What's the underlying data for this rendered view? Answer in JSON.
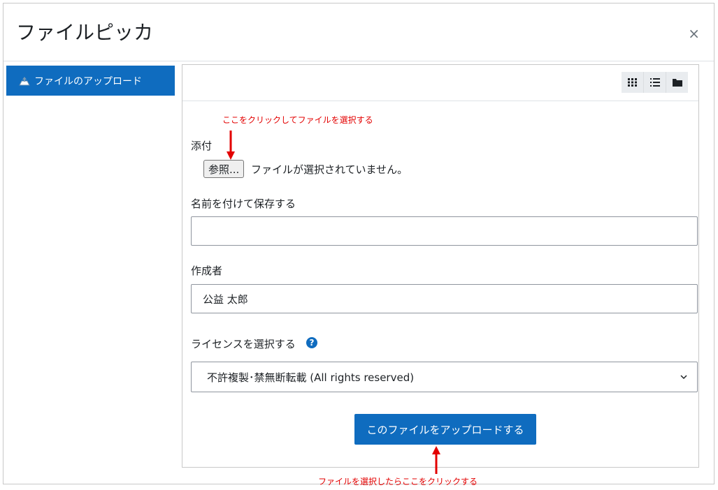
{
  "dialog": {
    "title": "ファイルピッカ",
    "close_label": "×"
  },
  "sidebar": {
    "items": [
      {
        "label": "ファイルのアップロード",
        "icon": "upload-icon",
        "active": true
      }
    ]
  },
  "toolbar": {
    "view_buttons": [
      {
        "icon": "grid-view-icon"
      },
      {
        "icon": "list-view-icon"
      },
      {
        "icon": "folder-view-icon"
      }
    ]
  },
  "form": {
    "attachment_label": "添付",
    "browse_label": "参照...",
    "no_file_text": "ファイルが選択されていません。",
    "save_as_label": "名前を付けて保存する",
    "save_as_value": "",
    "author_label": "作成者",
    "author_value": "公益 太郎",
    "license_label": "ライセンスを選択する",
    "license_value": "不許複製･禁無断転載 (All rights reserved)",
    "upload_label": "このファイルをアップロードする"
  },
  "annotations": {
    "top": "ここをクリックしてファイルを選択する",
    "bottom": "ファイルを選択したらここをクリックする"
  },
  "colors": {
    "primary": "#0f6cbf",
    "annotation": "#e30000"
  }
}
